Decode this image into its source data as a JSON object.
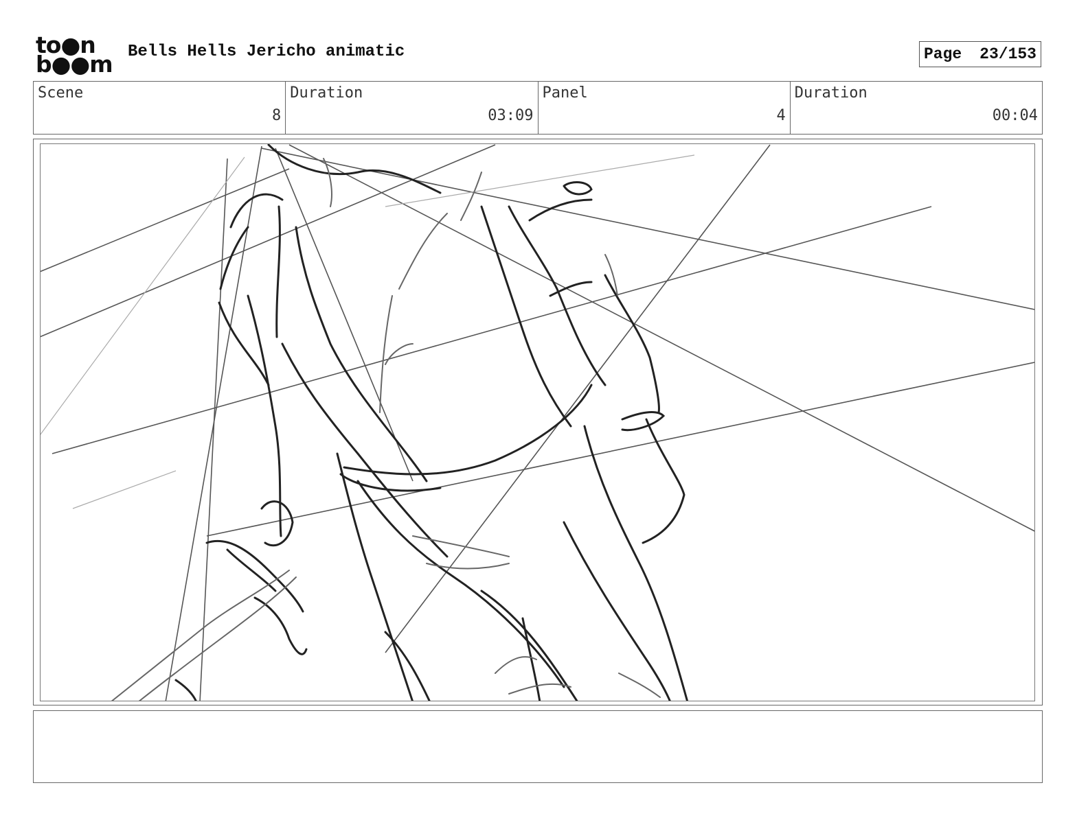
{
  "header": {
    "logo_top": "to●n",
    "logo_bottom": "b●●m",
    "title": "Bells Hells Jericho animatic",
    "page_label": "Page",
    "page_value": "23/153"
  },
  "info": {
    "scene_label": "Scene",
    "scene_value": "8",
    "duration_label": "Duration",
    "duration_value": "03:09",
    "panel_label": "Panel",
    "panel_value": "4",
    "panel_duration_label": "Duration",
    "panel_duration_value": "00:04"
  },
  "panel": {
    "drawing": "rough pencil sketch of a character's torso and legs with perspective lines"
  },
  "notes": {
    "text": ""
  }
}
